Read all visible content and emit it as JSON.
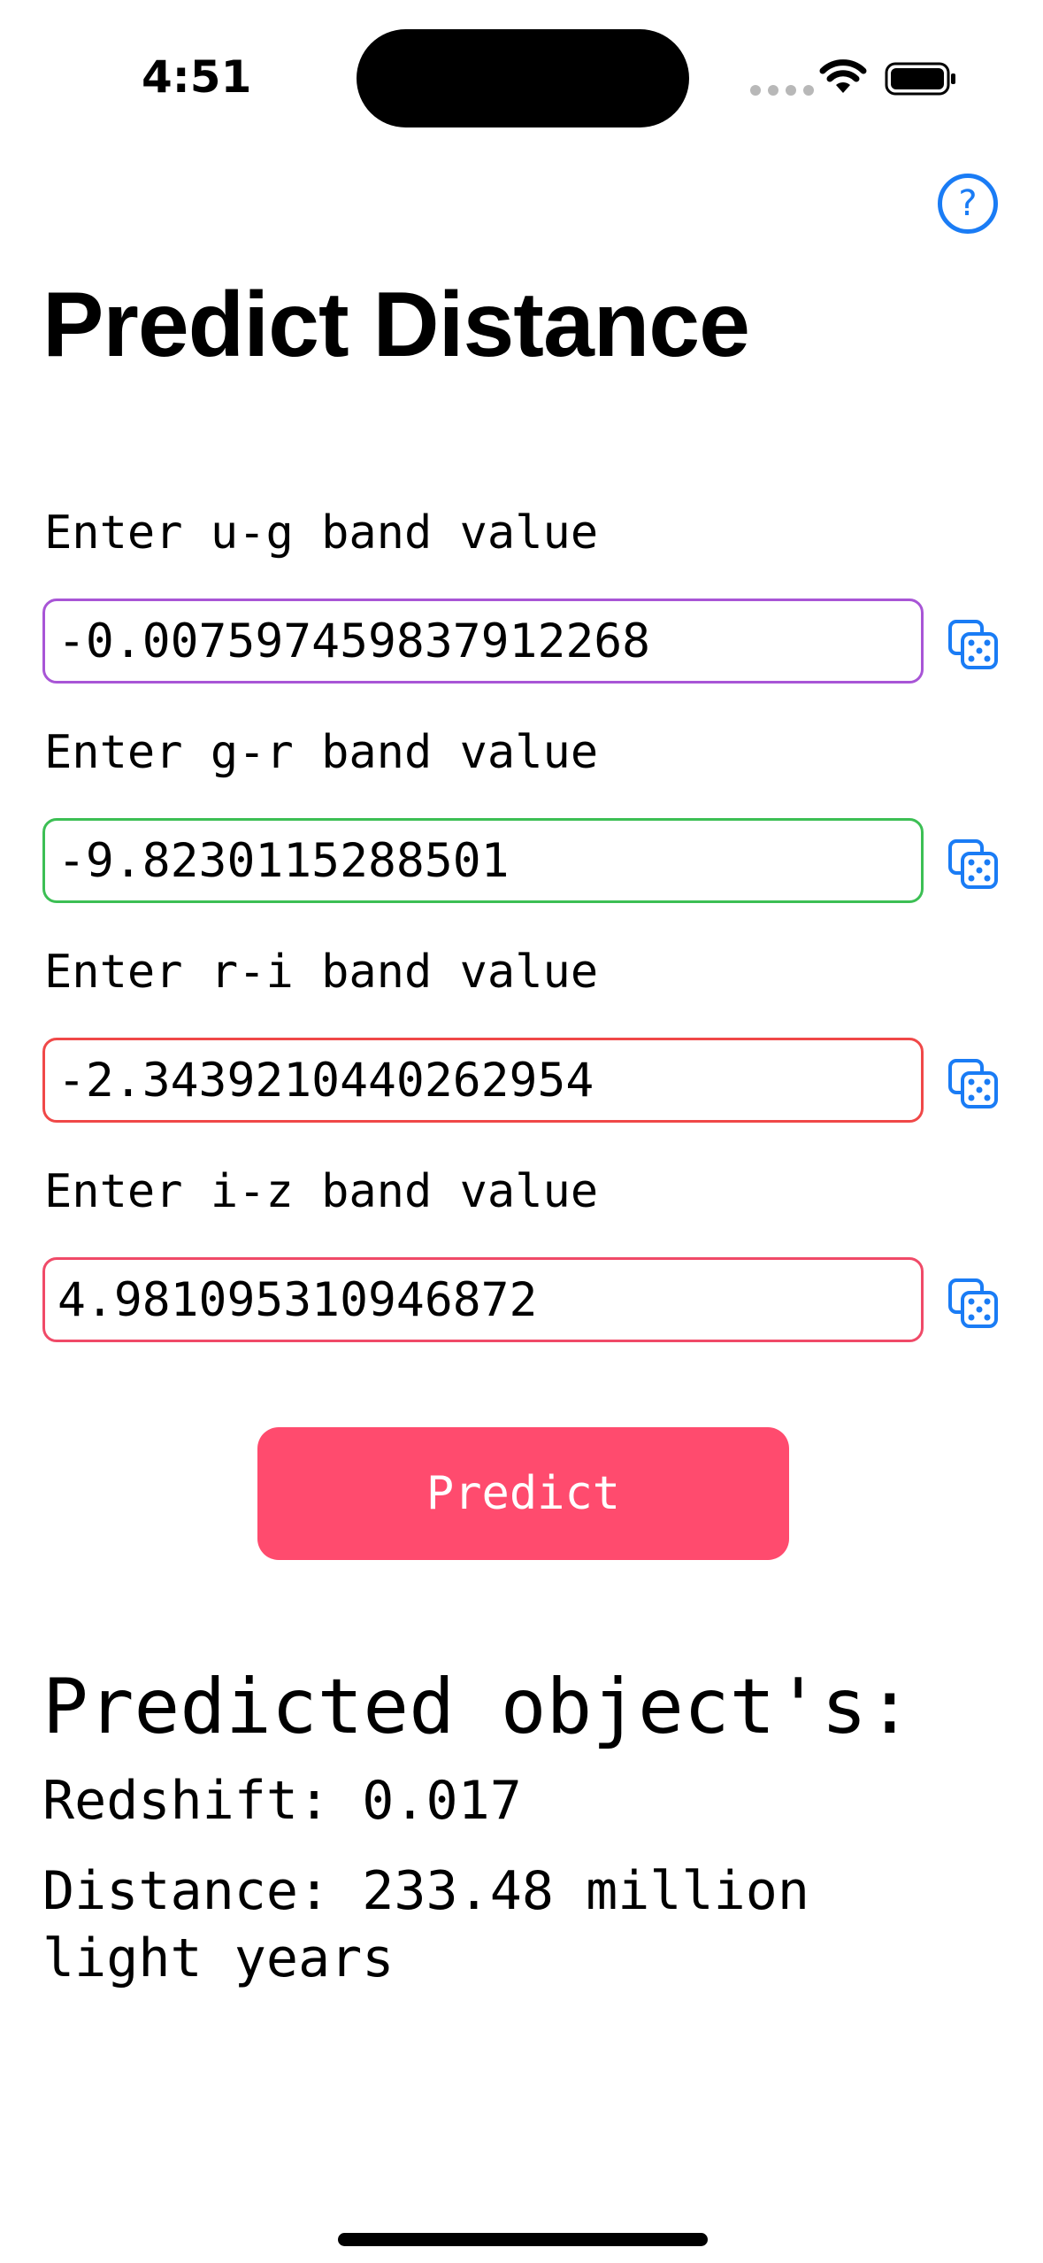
{
  "status_bar": {
    "time": "4:51"
  },
  "page": {
    "title": "Predict Distance"
  },
  "fields": [
    {
      "label": "Enter u-g band value",
      "value": "-0.007597459837912268",
      "border_color": "#a855d6"
    },
    {
      "label": "Enter g-r band value",
      "value": "-9.8230115288501",
      "border_color": "#3cbf54"
    },
    {
      "label": "Enter r-i band value",
      "value": "-2.3439210440262954",
      "border_color": "#f04848"
    },
    {
      "label": "Enter i-z band value",
      "value": "4.981095310946872",
      "border_color": "#f04a68"
    }
  ],
  "predict_button": {
    "label": "Predict",
    "color": "#ff4b6e"
  },
  "results": {
    "heading": "Predicted object's:",
    "redshift": "Redshift: 0.017",
    "distance": "Distance: 233.48 million light years"
  },
  "icons": {
    "help": "question-circle-icon",
    "dice": "dice-icon",
    "wifi": "wifi-icon",
    "battery": "battery-icon"
  },
  "accent_color": "#1a7cf5"
}
